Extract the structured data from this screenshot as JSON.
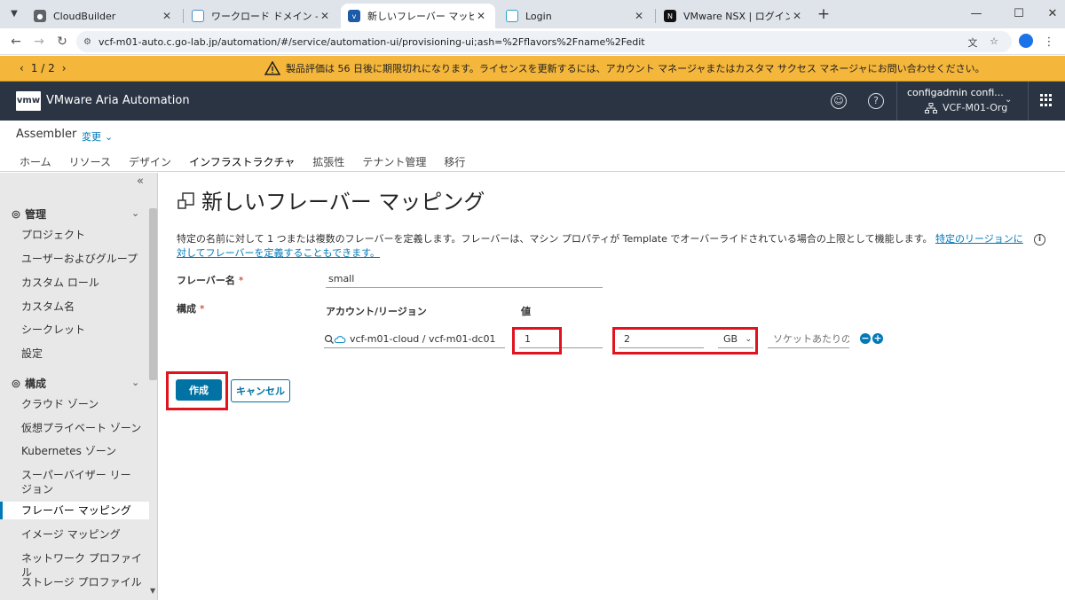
{
  "browser": {
    "tabs": [
      {
        "title": "CloudBuilder",
        "favicon": "globe-icon"
      },
      {
        "title": "ワークロード ドメイン - サマリ",
        "favicon": "vsphere-icon"
      },
      {
        "title": "新しいフレーバー マッピング - Assem",
        "favicon": "vmw-icon"
      },
      {
        "title": "Login",
        "favicon": "login-icon"
      },
      {
        "title": "VMware NSX | ログイン",
        "favicon": "nsx-icon"
      }
    ],
    "url": "vcf-m01-auto.c.go-lab.jp/automation/#/service/automation-ui/provisioning-ui;ash=%2Fflavors%2Fname%2Fedit"
  },
  "banner": {
    "pager": "1 / 2",
    "message": "製品評価は 56 日後に期限切れになります。ライセンスを更新するには、アカウント マネージャまたはカスタマ サクセス マネージャにお問い合わせください。"
  },
  "header": {
    "logo": "vmw",
    "app_name": "VMware Aria Automation",
    "user": "configadmin confi...",
    "org": "VCF-M01-Org"
  },
  "subnav": {
    "service": "Assembler",
    "change": "変更",
    "tabs": [
      "ホーム",
      "リソース",
      "デザイン",
      "インフラストラクチャ",
      "拡張性",
      "テナント管理",
      "移行"
    ]
  },
  "sidebar": {
    "collapse": "«",
    "section1": "管理",
    "items1": [
      "プロジェクト",
      "ユーザーおよびグループ",
      "カスタム ロール",
      "カスタム名",
      "シークレット",
      "設定"
    ],
    "section2": "構成",
    "items2": [
      "クラウド ゾーン",
      "仮想プライベート ゾーン",
      "Kubernetes ゾーン",
      "スーパーバイザー リージョン",
      "フレーバー マッピング",
      "イメージ マッピング",
      "ネットワーク プロファイル",
      "ストレージ プロファイル"
    ]
  },
  "main": {
    "title": "新しいフレーバー マッピング",
    "description": "特定の名前に対して 1 つまたは複数のフレーバーを定義します。フレーバーは、マシン プロパティが Template でオーバーライドされている場合の上限として機能します。",
    "link": "特定のリージョンに対してフレーバーを定義することもできます。",
    "flavor_label": "フレーバー名",
    "flavor_value": "small",
    "config_label": "構成",
    "col_account": "アカウント/リージョン",
    "col_value": "値",
    "account_value": "vcf-m01-cloud / vcf-m01-dc01",
    "cpu_value": "1",
    "memory_value": "2",
    "memory_unit": "GB",
    "socket_placeholder": "ソケットあたりのコア数",
    "create_button": "作成",
    "cancel_button": "キャンセル"
  }
}
